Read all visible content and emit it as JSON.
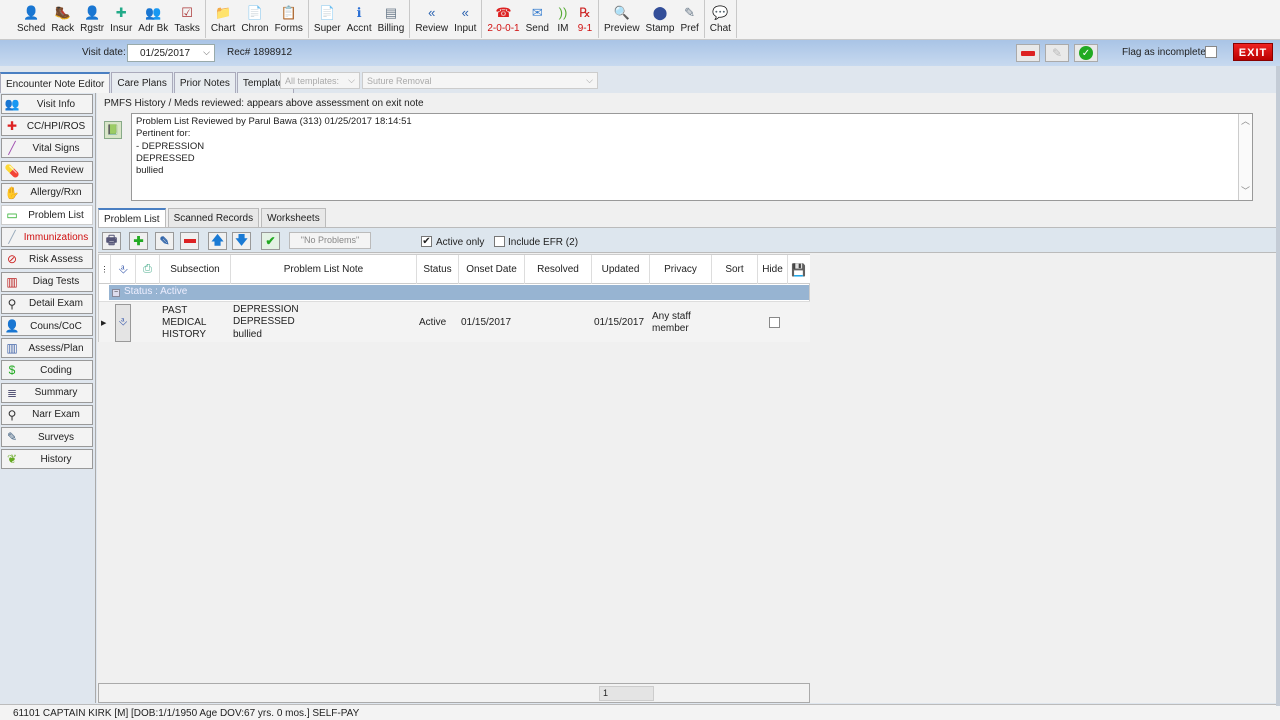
{
  "toolbar": {
    "groups": [
      [
        {
          "label": "Sched",
          "icon": "calendar-person-icon"
        },
        {
          "label": "Rack",
          "icon": "rack-icon"
        },
        {
          "label": "Rgstr",
          "icon": "register-icon"
        },
        {
          "label": "Insur",
          "icon": "insurance-icon"
        },
        {
          "label": "Adr Bk",
          "icon": "address-book-icon"
        },
        {
          "label": "Tasks",
          "icon": "tasks-icon"
        }
      ],
      [
        {
          "label": "Chart",
          "icon": "folder-icon"
        },
        {
          "label": "Chron",
          "icon": "chron-icon"
        },
        {
          "label": "Forms",
          "icon": "forms-icon"
        }
      ],
      [
        {
          "label": "Super",
          "icon": "super-icon"
        },
        {
          "label": "Accnt",
          "icon": "account-icon"
        },
        {
          "label": "Billing",
          "icon": "billing-icon"
        }
      ],
      [
        {
          "label": "Review",
          "icon": "review-arrow-icon"
        },
        {
          "label": "Input",
          "icon": "input-arrow-icon"
        }
      ],
      [
        {
          "label": "2-0-0-1",
          "icon": "phone-icon",
          "red": true
        },
        {
          "label": "Send",
          "icon": "envelope-icon"
        },
        {
          "label": "IM",
          "icon": "instant-message-icon"
        },
        {
          "label": "9-1",
          "icon": "rx-icon",
          "red": true
        }
      ],
      [
        {
          "label": "Preview",
          "icon": "preview-icon"
        },
        {
          "label": "Stamp",
          "icon": "stamp-icon"
        },
        {
          "label": "Pref",
          "icon": "preferences-icon"
        }
      ],
      [
        {
          "label": "Chat",
          "icon": "chat-icon"
        }
      ]
    ]
  },
  "visit": {
    "date_label": "Visit date:",
    "date_value": "01/25/2017",
    "rec": "Rec# 1898912",
    "flag_label": "Flag as incomplete",
    "exit_label": "EXIT"
  },
  "tabs": [
    {
      "label": "Encounter Note Editor",
      "active": true
    },
    {
      "label": "Care Plans"
    },
    {
      "label": "Prior Notes"
    },
    {
      "label": "Templates"
    }
  ],
  "templates": {
    "filter": "All templates:",
    "selected": "Suture Removal"
  },
  "sidebar": {
    "items": [
      {
        "label": "Visit Info",
        "icon": "visit-info-icon"
      },
      {
        "label": "CC/HPI/ROS",
        "icon": "medical-kit-icon"
      },
      {
        "label": "Vital Signs",
        "icon": "thermometer-icon"
      },
      {
        "label": "Med Review",
        "icon": "med-review-icon"
      },
      {
        "label": "Allergy/Rxn",
        "icon": "allergy-icon"
      },
      {
        "label": "Problem List",
        "icon": "problem-list-icon",
        "active": true
      },
      {
        "label": "Immunizations",
        "icon": "syringe-icon",
        "red": true
      },
      {
        "label": "Risk Assess",
        "icon": "no-smoking-icon"
      },
      {
        "label": "Diag Tests",
        "icon": "test-tubes-icon"
      },
      {
        "label": "Detail Exam",
        "icon": "stethoscope-icon"
      },
      {
        "label": "Couns/CoC",
        "icon": "counsel-icon"
      },
      {
        "label": "Assess/Plan",
        "icon": "book-open-icon"
      },
      {
        "label": "Coding",
        "icon": "dollar-icon"
      },
      {
        "label": "Summary",
        "icon": "summary-icon"
      },
      {
        "label": "Narr Exam",
        "icon": "stethoscope-icon"
      },
      {
        "label": "Surveys",
        "icon": "survey-icon"
      },
      {
        "label": "History",
        "icon": "family-tree-icon"
      }
    ]
  },
  "pmfs": {
    "header": "PMFS History / Meds reviewed: appears above assessment on exit note",
    "lines": [
      "Problem List Reviewed by Parul Bawa (313) 01/25/2017 18:14:51",
      "Pertinent for:",
      "- DEPRESSION",
      "DEPRESSED",
      "bullied"
    ]
  },
  "subtabs": [
    {
      "label": "Problem List",
      "active": true
    },
    {
      "label": "Scanned Records"
    },
    {
      "label": "Worksheets"
    }
  ],
  "problem_toolbar": {
    "no_problems": "\"No Problems\"",
    "active_only_label": "Active only",
    "active_only_checked": true,
    "include_efr_label": "Include EFR (2)",
    "include_efr_checked": false
  },
  "grid": {
    "columns": [
      "Subsection",
      "Problem List Note",
      "Status",
      "Onset Date",
      "Resolved",
      "Updated",
      "Privacy",
      "Sort",
      "Hide"
    ],
    "group_label": "Status : Active",
    "rows": [
      {
        "subsection": "PAST MEDICAL HISTORY",
        "note": [
          "DEPRESSION",
          "DEPRESSED",
          "bullied"
        ],
        "status": "Active",
        "onset": "01/15/2017",
        "resolved": "",
        "updated": "01/15/2017",
        "privacy": "Any staff member",
        "sort": "",
        "hide": false
      }
    ]
  },
  "pager": {
    "page": "1"
  },
  "status_bar": "61101 CAPTAIN KIRK [M] [DOB:1/1/1950  Age DOV:67 yrs. 0 mos.] SELF-PAY"
}
